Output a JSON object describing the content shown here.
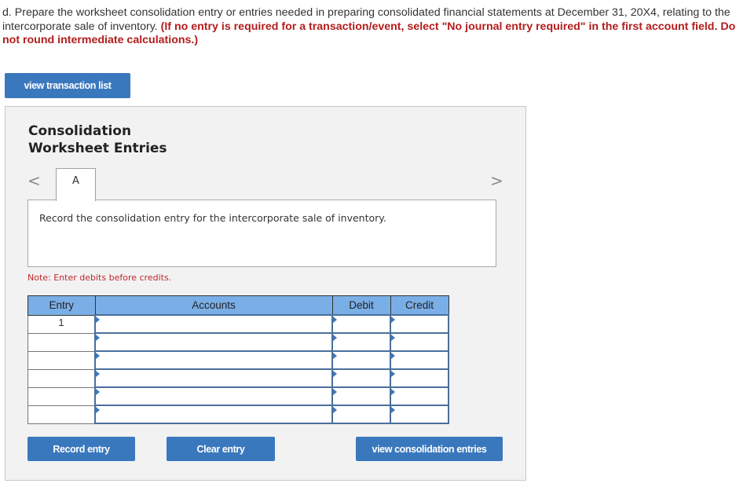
{
  "question": {
    "text": "d. Prepare the worksheet consolidation entry or entries needed in preparing consolidated financial statements at December 31, 20X4, relating to the intercorporate sale of inventory.",
    "instruction": "(If no entry is required for a transaction/event, select \"No journal entry required\" in the first account field. Do not round intermediate calculations.)"
  },
  "buttons": {
    "view_transaction_list": "view transaction list",
    "record_entry": "Record entry",
    "clear_entry": "Clear entry",
    "view_consolidation_entries": "view consolidation entries"
  },
  "panel": {
    "title_line1": "Consolidation",
    "title_line2": "Worksheet Entries",
    "prev_label": "<",
    "next_label": ">",
    "tabs": [
      {
        "label": "A",
        "active": true
      }
    ],
    "instruction": "Record the consolidation entry for the intercorporate sale of inventory.",
    "note": "Note: Enter debits before credits."
  },
  "table": {
    "headers": {
      "entry": "Entry",
      "accounts": "Accounts",
      "debit": "Debit",
      "credit": "Credit"
    },
    "rows": [
      {
        "entry": "1",
        "account": "",
        "debit": "",
        "credit": ""
      },
      {
        "entry": "",
        "account": "",
        "debit": "",
        "credit": ""
      },
      {
        "entry": "",
        "account": "",
        "debit": "",
        "credit": ""
      },
      {
        "entry": "",
        "account": "",
        "debit": "",
        "credit": ""
      },
      {
        "entry": "",
        "account": "",
        "debit": "",
        "credit": ""
      },
      {
        "entry": "",
        "account": "",
        "debit": "",
        "credit": ""
      }
    ]
  },
  "colors": {
    "button_blue": "#3a78bd",
    "header_blue": "#7aaee6",
    "instruction_red": "#b31c1c",
    "panel_bg": "#f2f2f2"
  }
}
